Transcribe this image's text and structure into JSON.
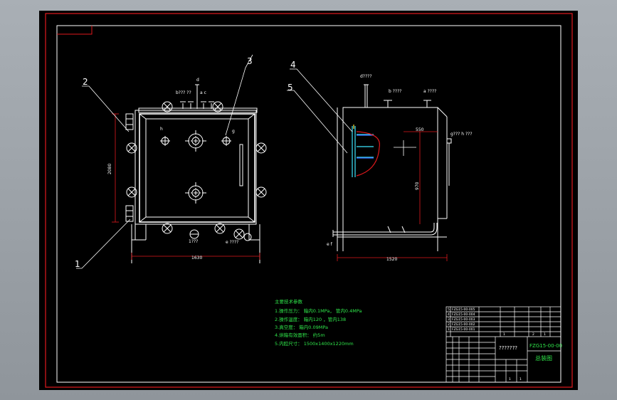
{
  "colors": {
    "background": "#000000",
    "frame_outer": "#e0191d",
    "frame_inner": "#ffffff",
    "geometry": "#ffffff",
    "dimension": "#e0191d",
    "notes": "#2fe64a",
    "cyan": "#3ee6ff",
    "yellow": "#ffe23a",
    "blue": "#3a6bff"
  },
  "left_view": {
    "callouts": [
      "2",
      "3",
      "1"
    ],
    "labels": {
      "top": "d",
      "top_left": "b??? ??",
      "ac": "a  c",
      "h": "h",
      "g": "g",
      "bottom": "1???",
      "bottom_right": "e ????"
    },
    "dim_width": "1630",
    "dim_height": "2080"
  },
  "right_view": {
    "callouts": [
      "4",
      "5"
    ],
    "labels": {
      "top": "d????",
      "b": "b  ????",
      "a": "a ????",
      "gh": "g??? h ???",
      "ef": "e  f"
    },
    "dim_width": "1520",
    "dim_550": "550",
    "dim_970": "970"
  },
  "notes": {
    "title": "主要技术参数",
    "lines": [
      "1.操作压力： 箱内0.1MPa， 管内0.4MPa",
      "2.操作温度： 箱内120   ，管内138",
      "3.真空度：    箱内0.09MPa",
      "4.烘箱有效面积： 约5m",
      "5.内腔尺寸： 1500x1400x1220mm"
    ]
  },
  "title_block": {
    "drawing_no": "FZG15-00-00",
    "drawing_name": "总装图",
    "placeholder": "???????",
    "parts": [
      {
        "no": "5",
        "code": "FZG15-00-005"
      },
      {
        "no": "4",
        "code": "FZG15-00-004"
      },
      {
        "no": "3",
        "code": "FZG15-00-003"
      },
      {
        "no": "2",
        "code": "FZG15-00-002"
      },
      {
        "no": "1",
        "code": "FZG15-00-001"
      }
    ],
    "row_numbers": [
      "1",
      "2",
      "1"
    ],
    "small_nums": [
      "1",
      "1"
    ]
  }
}
